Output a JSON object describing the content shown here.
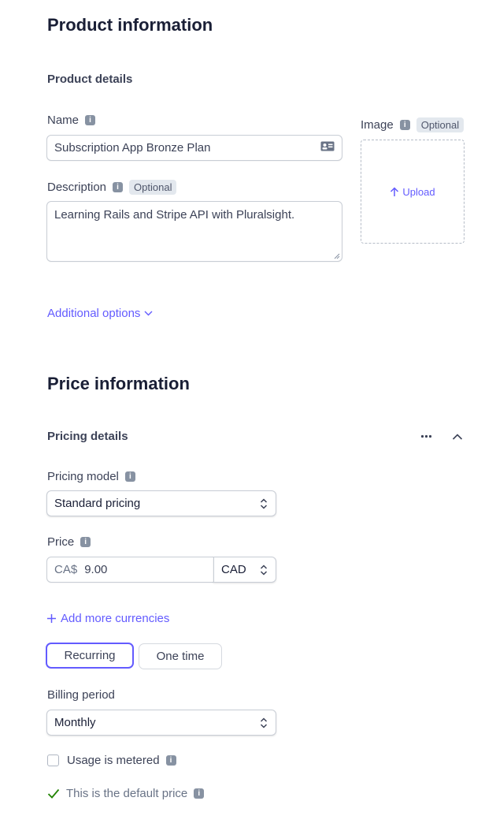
{
  "product": {
    "section_title": "Product information",
    "subsection_title": "Product details",
    "name_label": "Name",
    "name_value": "Subscription App Bronze Plan",
    "description_label": "Description",
    "optional_badge": "Optional",
    "description_value": "Learning Rails and Stripe API with Pluralsight.",
    "image_label": "Image",
    "image_optional_badge": "Optional",
    "upload_label": "Upload",
    "additional_options": "Additional options"
  },
  "price": {
    "section_title": "Price information",
    "subsection_title": "Pricing details",
    "pricing_model_label": "Pricing model",
    "pricing_model_value": "Standard pricing",
    "price_label": "Price",
    "currency_prefix": "CA$",
    "amount": "9.00",
    "currency": "CAD",
    "add_currencies": "Add more currencies",
    "recurring_label": "Recurring",
    "one_time_label": "One time",
    "billing_period_label": "Billing period",
    "billing_period_value": "Monthly",
    "usage_metered_label": "Usage is metered",
    "usage_metered_checked": false,
    "default_price_label": "This is the default price"
  },
  "colors": {
    "accent": "#635bff",
    "text": "#1a1f36",
    "muted": "#8792a2",
    "success": "#228403"
  },
  "icons": {
    "info": "info-icon",
    "contact_card": "contact-card-icon",
    "upload_arrow": "arrow-up-icon",
    "chevron_down": "chevron-down-icon",
    "chevron_up": "chevron-up-icon",
    "more": "more-horizontal-icon",
    "plus": "plus-icon",
    "check": "check-icon",
    "select_arrows": "select-arrows-icon"
  }
}
